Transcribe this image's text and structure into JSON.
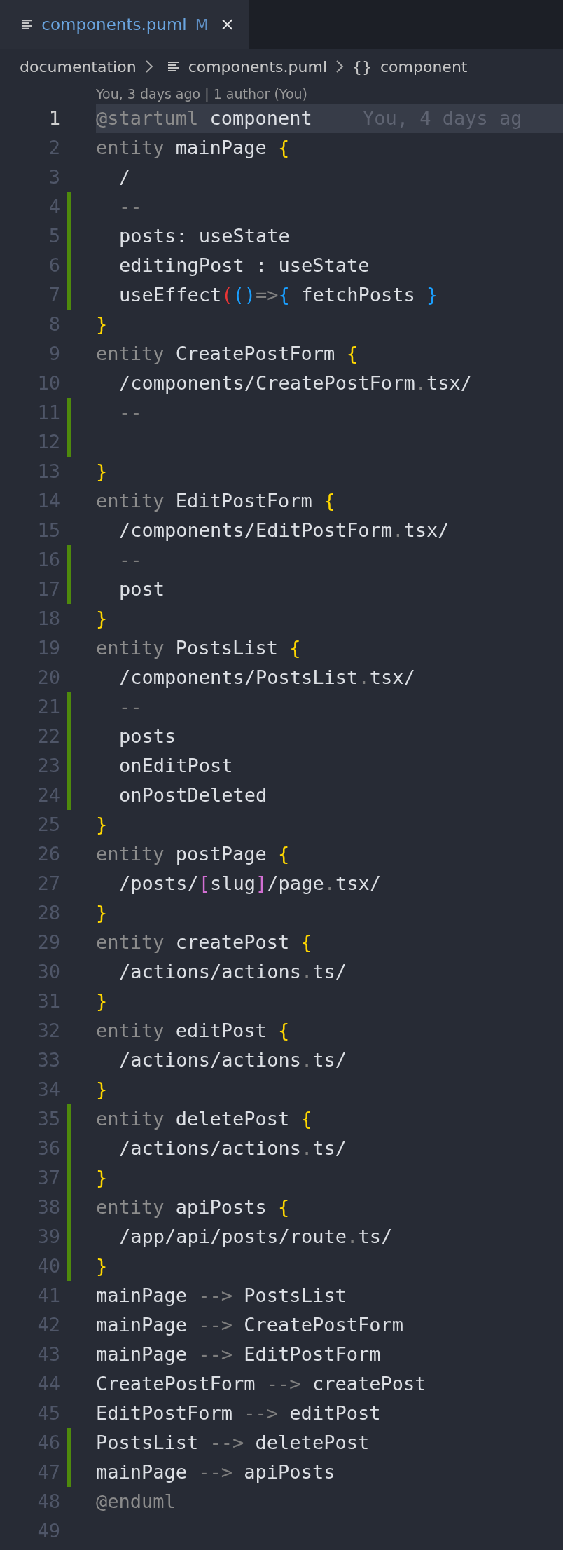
{
  "tab": {
    "filename": "components.puml",
    "status": "M",
    "selected": true
  },
  "breadcrumb": {
    "folder": "documentation",
    "file": "components.puml",
    "symbol_glyph": "{}",
    "symbol": "component"
  },
  "codelens": "You, 3 days ago | 1 author (You)",
  "lines": [
    {
      "number": "1",
      "current": true,
      "modified": false,
      "indented": false,
      "tokens": [
        {
          "kind": "keyword",
          "text": "@startuml "
        },
        {
          "kind": "text",
          "text": "component"
        }
      ],
      "blame": "You, 4 days ag"
    },
    {
      "number": "2",
      "current": false,
      "modified": false,
      "indented": false,
      "tokens": [
        {
          "kind": "keyword",
          "text": "entity "
        },
        {
          "kind": "text",
          "text": "mainPage "
        },
        {
          "kind": "brace",
          "text": "{"
        }
      ]
    },
    {
      "number": "3",
      "current": false,
      "modified": false,
      "indented": true,
      "tokens": [
        {
          "kind": "text",
          "text": "/"
        }
      ]
    },
    {
      "number": "4",
      "current": false,
      "modified": true,
      "indented": true,
      "tokens": [
        {
          "kind": "dim",
          "text": "--"
        }
      ]
    },
    {
      "number": "5",
      "current": false,
      "modified": true,
      "indented": true,
      "tokens": [
        {
          "kind": "text",
          "text": "posts: useState"
        }
      ]
    },
    {
      "number": "6",
      "current": false,
      "modified": true,
      "indented": true,
      "tokens": [
        {
          "kind": "text",
          "text": "editingPost : useState"
        }
      ]
    },
    {
      "number": "7",
      "current": false,
      "modified": true,
      "indented": true,
      "tokens": [
        {
          "kind": "text",
          "text": "useEffect"
        },
        {
          "kind": "paren-outer",
          "text": "("
        },
        {
          "kind": "paren-inner",
          "text": "()"
        },
        {
          "kind": "dim",
          "text": "=>"
        },
        {
          "kind": "paren-inner",
          "text": "{"
        },
        {
          "kind": "text",
          "text": " fetchPosts "
        },
        {
          "kind": "paren-inner",
          "text": "}"
        }
      ]
    },
    {
      "number": "8",
      "current": false,
      "modified": false,
      "indented": false,
      "tokens": [
        {
          "kind": "brace",
          "text": "}"
        }
      ]
    },
    {
      "number": "9",
      "current": false,
      "modified": false,
      "indented": false,
      "tokens": [
        {
          "kind": "keyword",
          "text": "entity "
        },
        {
          "kind": "text",
          "text": "CreatePostForm "
        },
        {
          "kind": "brace",
          "text": "{"
        }
      ]
    },
    {
      "number": "10",
      "current": false,
      "modified": false,
      "indented": true,
      "tokens": [
        {
          "kind": "text",
          "text": "/components/CreatePostForm"
        },
        {
          "kind": "dim",
          "text": "."
        },
        {
          "kind": "text",
          "text": "tsx/"
        }
      ]
    },
    {
      "number": "11",
      "current": false,
      "modified": true,
      "indented": true,
      "tokens": [
        {
          "kind": "dim",
          "text": "--"
        }
      ]
    },
    {
      "number": "12",
      "current": false,
      "modified": true,
      "indented": true
    },
    {
      "number": "13",
      "current": false,
      "modified": false,
      "indented": false,
      "tokens": [
        {
          "kind": "brace",
          "text": "}"
        }
      ]
    },
    {
      "number": "14",
      "current": false,
      "modified": false,
      "indented": false,
      "tokens": [
        {
          "kind": "keyword",
          "text": "entity "
        },
        {
          "kind": "text",
          "text": "EditPostForm "
        },
        {
          "kind": "brace",
          "text": "{"
        }
      ]
    },
    {
      "number": "15",
      "current": false,
      "modified": false,
      "indented": true,
      "tokens": [
        {
          "kind": "text",
          "text": "/components/EditPostForm"
        },
        {
          "kind": "dim",
          "text": "."
        },
        {
          "kind": "text",
          "text": "tsx/"
        }
      ]
    },
    {
      "number": "16",
      "current": false,
      "modified": true,
      "indented": true,
      "tokens": [
        {
          "kind": "dim",
          "text": "--"
        }
      ]
    },
    {
      "number": "17",
      "current": false,
      "modified": true,
      "indented": true,
      "tokens": [
        {
          "kind": "text",
          "text": "post"
        }
      ]
    },
    {
      "number": "18",
      "current": false,
      "modified": false,
      "indented": false,
      "tokens": [
        {
          "kind": "brace",
          "text": "}"
        }
      ]
    },
    {
      "number": "19",
      "current": false,
      "modified": false,
      "indented": false,
      "tokens": [
        {
          "kind": "keyword",
          "text": "entity "
        },
        {
          "kind": "text",
          "text": "PostsList "
        },
        {
          "kind": "brace",
          "text": "{"
        }
      ]
    },
    {
      "number": "20",
      "current": false,
      "modified": false,
      "indented": true,
      "tokens": [
        {
          "kind": "text",
          "text": "/components/PostsList"
        },
        {
          "kind": "dim",
          "text": "."
        },
        {
          "kind": "text",
          "text": "tsx/"
        }
      ]
    },
    {
      "number": "21",
      "current": false,
      "modified": true,
      "indented": true,
      "tokens": [
        {
          "kind": "dim",
          "text": "--"
        }
      ]
    },
    {
      "number": "22",
      "current": false,
      "modified": true,
      "indented": true,
      "tokens": [
        {
          "kind": "text",
          "text": "posts"
        }
      ]
    },
    {
      "number": "23",
      "current": false,
      "modified": true,
      "indented": true,
      "tokens": [
        {
          "kind": "text",
          "text": "onEditPost"
        }
      ]
    },
    {
      "number": "24",
      "current": false,
      "modified": true,
      "indented": true,
      "tokens": [
        {
          "kind": "text",
          "text": "onPostDeleted"
        }
      ]
    },
    {
      "number": "25",
      "current": false,
      "modified": false,
      "indented": false,
      "tokens": [
        {
          "kind": "brace",
          "text": "}"
        }
      ]
    },
    {
      "number": "26",
      "current": false,
      "modified": false,
      "indented": false,
      "tokens": [
        {
          "kind": "keyword",
          "text": "entity "
        },
        {
          "kind": "text",
          "text": "postPage "
        },
        {
          "kind": "brace",
          "text": "{"
        }
      ]
    },
    {
      "number": "27",
      "current": false,
      "modified": false,
      "indented": true,
      "tokens": [
        {
          "kind": "text",
          "text": "/posts/"
        },
        {
          "kind": "bracket",
          "text": "["
        },
        {
          "kind": "text",
          "text": "slug"
        },
        {
          "kind": "bracket",
          "text": "]"
        },
        {
          "kind": "text",
          "text": "/page"
        },
        {
          "kind": "dim",
          "text": "."
        },
        {
          "kind": "text",
          "text": "tsx/"
        }
      ]
    },
    {
      "number": "28",
      "current": false,
      "modified": false,
      "indented": false,
      "tokens": [
        {
          "kind": "brace",
          "text": "}"
        }
      ]
    },
    {
      "number": "29",
      "current": false,
      "modified": false,
      "indented": false,
      "tokens": [
        {
          "kind": "keyword",
          "text": "entity "
        },
        {
          "kind": "text",
          "text": "createPost "
        },
        {
          "kind": "brace",
          "text": "{"
        }
      ]
    },
    {
      "number": "30",
      "current": false,
      "modified": false,
      "indented": true,
      "tokens": [
        {
          "kind": "text",
          "text": "/actions/actions"
        },
        {
          "kind": "dim",
          "text": "."
        },
        {
          "kind": "text",
          "text": "ts/"
        }
      ]
    },
    {
      "number": "31",
      "current": false,
      "modified": false,
      "indented": false,
      "tokens": [
        {
          "kind": "brace",
          "text": "}"
        }
      ]
    },
    {
      "number": "32",
      "current": false,
      "modified": false,
      "indented": false,
      "tokens": [
        {
          "kind": "keyword",
          "text": "entity "
        },
        {
          "kind": "text",
          "text": "editPost "
        },
        {
          "kind": "brace",
          "text": "{"
        }
      ]
    },
    {
      "number": "33",
      "current": false,
      "modified": false,
      "indented": true,
      "tokens": [
        {
          "kind": "text",
          "text": "/actions/actions"
        },
        {
          "kind": "dim",
          "text": "."
        },
        {
          "kind": "text",
          "text": "ts/"
        }
      ]
    },
    {
      "number": "34",
      "current": false,
      "modified": false,
      "indented": false,
      "tokens": [
        {
          "kind": "brace",
          "text": "}"
        }
      ]
    },
    {
      "number": "35",
      "current": false,
      "modified": true,
      "indented": false,
      "tokens": [
        {
          "kind": "keyword",
          "text": "entity "
        },
        {
          "kind": "text",
          "text": "deletePost "
        },
        {
          "kind": "brace",
          "text": "{"
        }
      ]
    },
    {
      "number": "36",
      "current": false,
      "modified": true,
      "indented": true,
      "tokens": [
        {
          "kind": "text",
          "text": "/actions/actions"
        },
        {
          "kind": "dim",
          "text": "."
        },
        {
          "kind": "text",
          "text": "ts/"
        }
      ]
    },
    {
      "number": "37",
      "current": false,
      "modified": true,
      "indented": false,
      "tokens": [
        {
          "kind": "brace",
          "text": "}"
        }
      ]
    },
    {
      "number": "38",
      "current": false,
      "modified": true,
      "indented": false,
      "tokens": [
        {
          "kind": "keyword",
          "text": "entity "
        },
        {
          "kind": "text",
          "text": "apiPosts "
        },
        {
          "kind": "brace",
          "text": "{"
        }
      ]
    },
    {
      "number": "39",
      "current": false,
      "modified": true,
      "indented": true,
      "tokens": [
        {
          "kind": "text",
          "text": "/app/api/posts/route"
        },
        {
          "kind": "dim",
          "text": "."
        },
        {
          "kind": "text",
          "text": "ts/"
        }
      ]
    },
    {
      "number": "40",
      "current": false,
      "modified": true,
      "indented": false,
      "tokens": [
        {
          "kind": "brace",
          "text": "}"
        }
      ]
    },
    {
      "number": "41",
      "current": false,
      "modified": false,
      "indented": false,
      "tokens": [
        {
          "kind": "text",
          "text": "mainPage "
        },
        {
          "kind": "dim",
          "text": "-->"
        },
        {
          "kind": "text",
          "text": " PostsList"
        }
      ]
    },
    {
      "number": "42",
      "current": false,
      "modified": false,
      "indented": false,
      "tokens": [
        {
          "kind": "text",
          "text": "mainPage "
        },
        {
          "kind": "dim",
          "text": "-->"
        },
        {
          "kind": "text",
          "text": " CreatePostForm"
        }
      ]
    },
    {
      "number": "43",
      "current": false,
      "modified": false,
      "indented": false,
      "tokens": [
        {
          "kind": "text",
          "text": "mainPage "
        },
        {
          "kind": "dim",
          "text": "-->"
        },
        {
          "kind": "text",
          "text": " EditPostForm"
        }
      ]
    },
    {
      "number": "44",
      "current": false,
      "modified": false,
      "indented": false,
      "tokens": [
        {
          "kind": "text",
          "text": "CreatePostForm "
        },
        {
          "kind": "dim",
          "text": "-->"
        },
        {
          "kind": "text",
          "text": " createPost"
        }
      ]
    },
    {
      "number": "45",
      "current": false,
      "modified": false,
      "indented": false,
      "tokens": [
        {
          "kind": "text",
          "text": "EditPostForm "
        },
        {
          "kind": "dim",
          "text": "-->"
        },
        {
          "kind": "text",
          "text": " editPost"
        }
      ]
    },
    {
      "number": "46",
      "current": false,
      "modified": true,
      "indented": false,
      "tokens": [
        {
          "kind": "text",
          "text": "PostsList "
        },
        {
          "kind": "dim",
          "text": "-->"
        },
        {
          "kind": "text",
          "text": " deletePost"
        }
      ]
    },
    {
      "number": "47",
      "current": false,
      "modified": true,
      "indented": false,
      "tokens": [
        {
          "kind": "text",
          "text": "mainPage "
        },
        {
          "kind": "dim",
          "text": "-->"
        },
        {
          "kind": "text",
          "text": " apiPosts"
        }
      ]
    },
    {
      "number": "48",
      "current": false,
      "modified": false,
      "indented": false,
      "tokens": [
        {
          "kind": "keyword",
          "text": "@enduml"
        }
      ]
    },
    {
      "number": "49",
      "current": false,
      "modified": false,
      "indented": false
    }
  ]
}
